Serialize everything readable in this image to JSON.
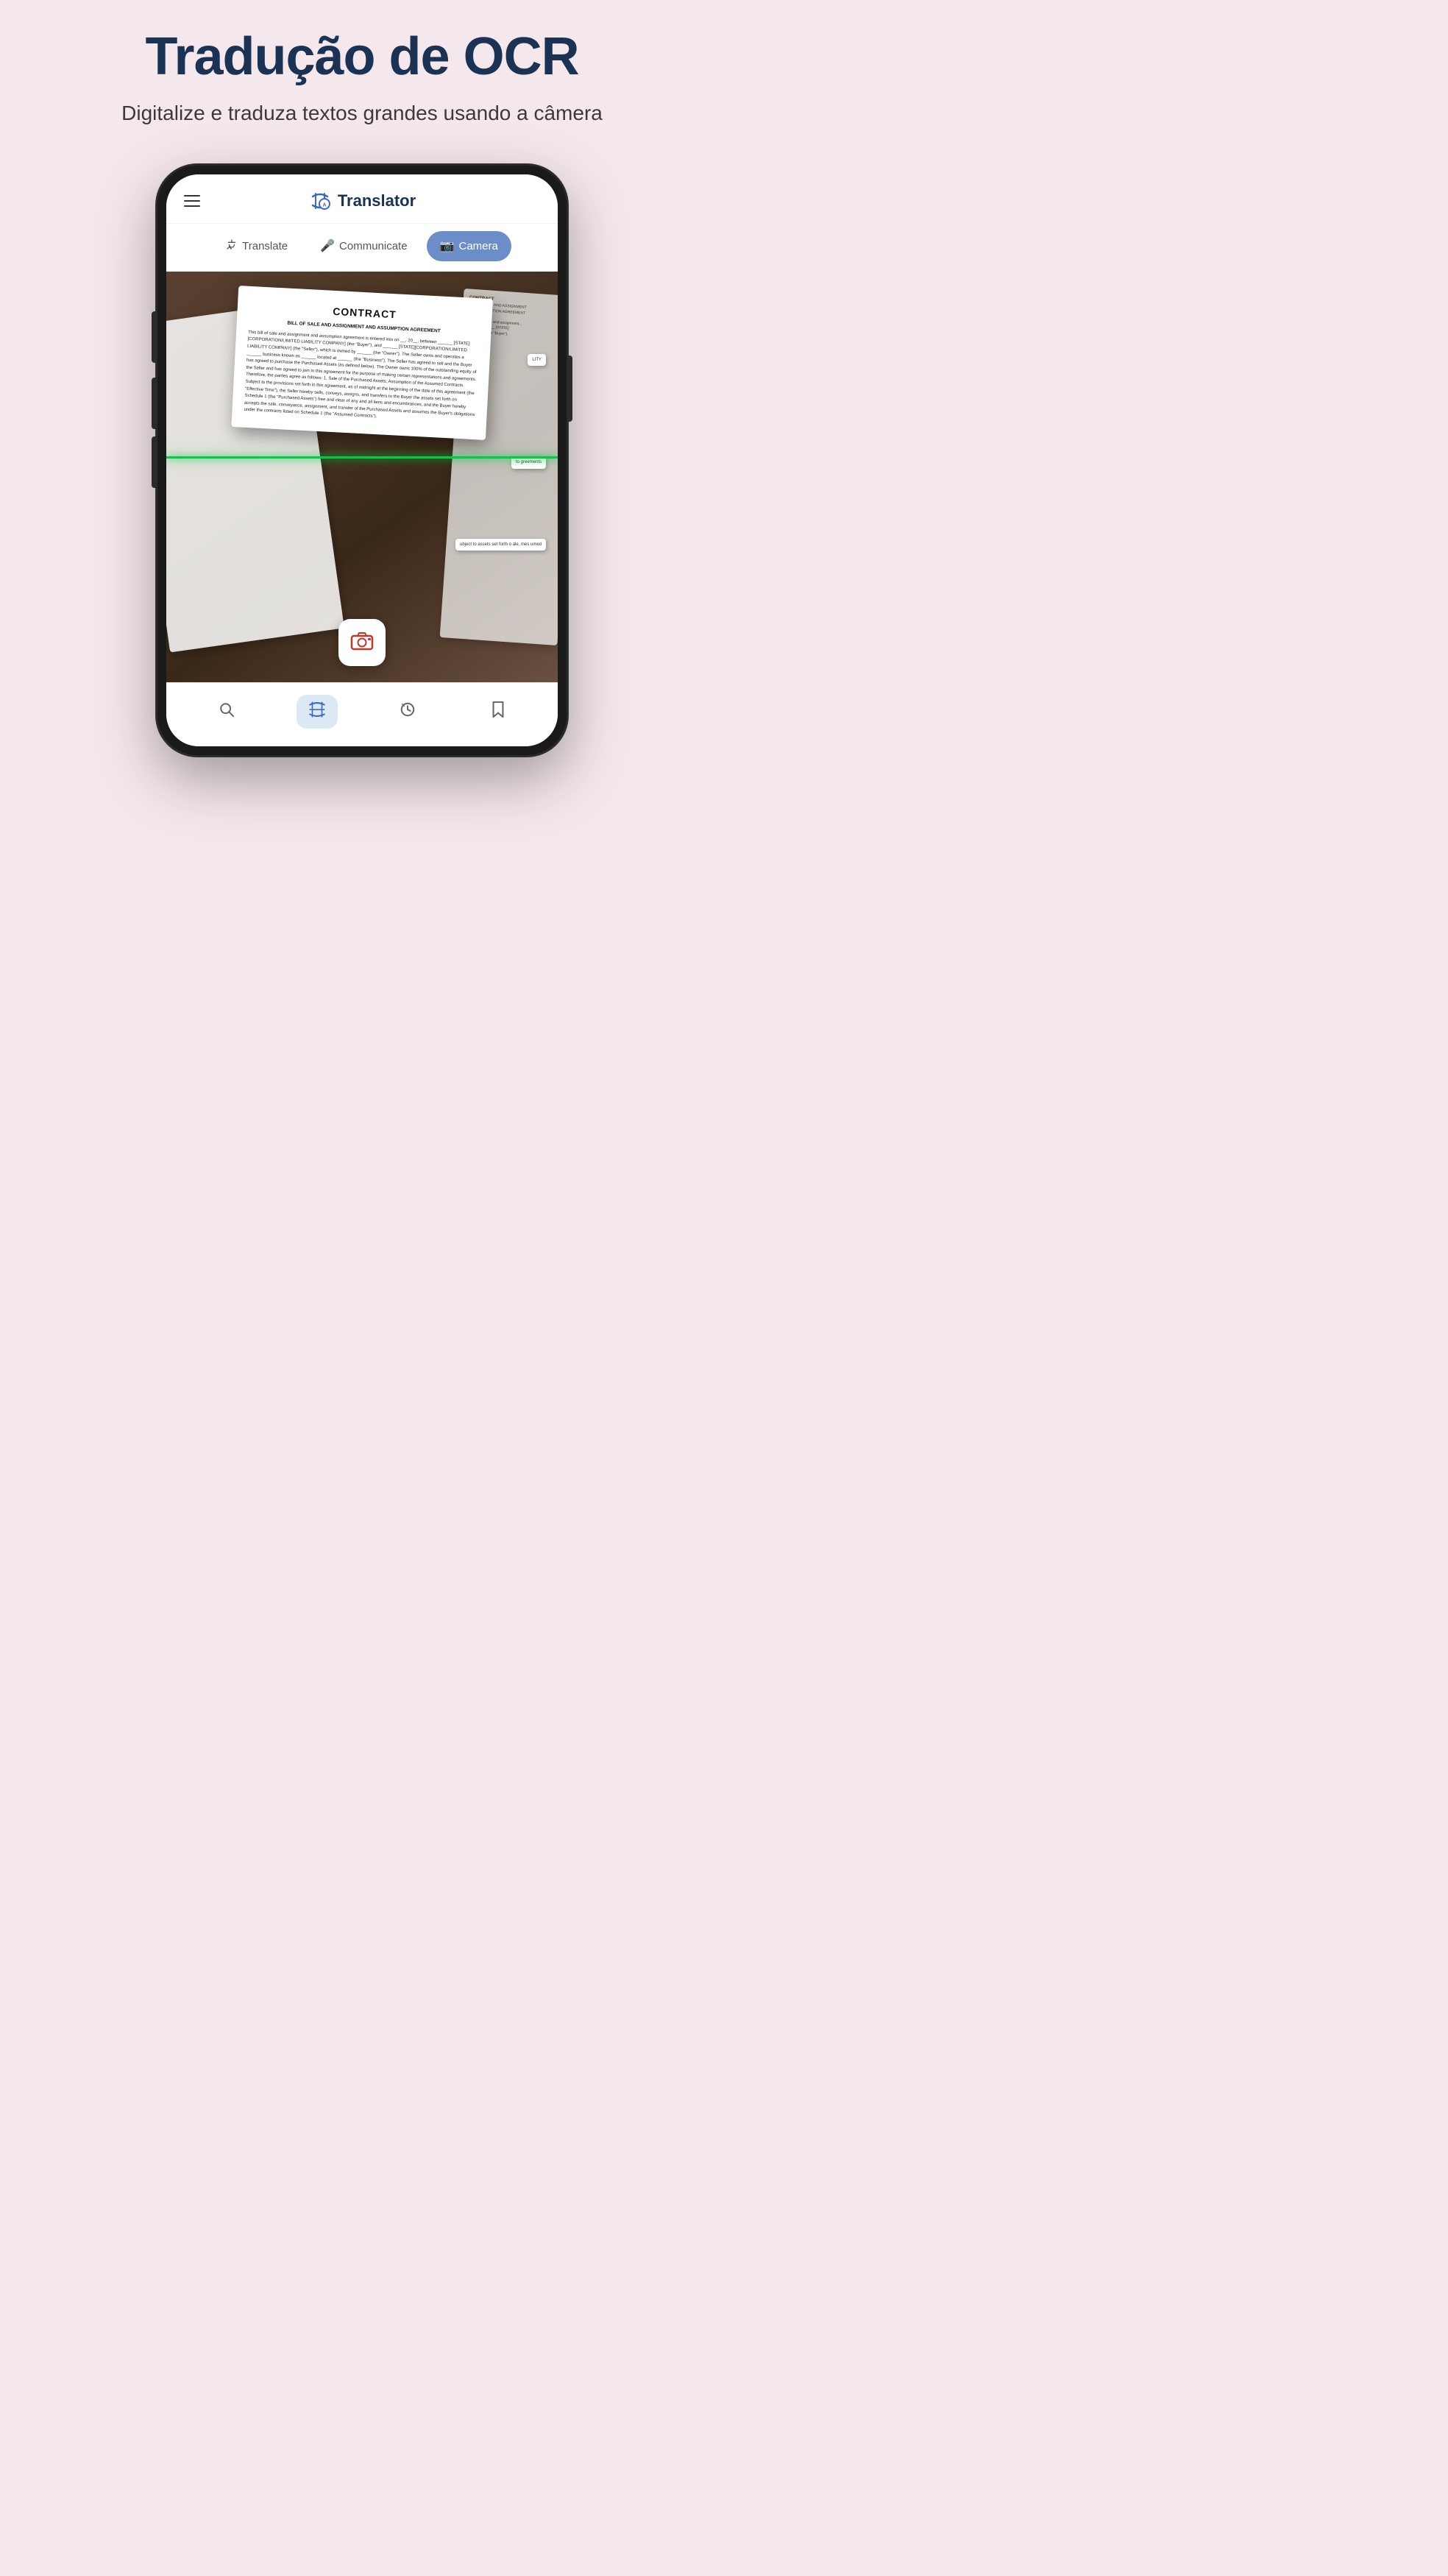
{
  "page": {
    "background_color": "#f5e8ec",
    "headline": "Tradução de OCR",
    "subtitle": "Digitalize e traduza textos grandes\nusando a câmera"
  },
  "app": {
    "title": "Translator"
  },
  "tabs": [
    {
      "id": "translate",
      "label": "Translate",
      "icon": "🔄",
      "active": false
    },
    {
      "id": "communicate",
      "label": "Communicate",
      "icon": "🎤",
      "active": false
    },
    {
      "id": "camera",
      "label": "Camera",
      "icon": "📷",
      "active": true
    }
  ],
  "contract": {
    "title": "CONTRACT",
    "subtitle": "BILL OF SALE AND ASSIGNMENT AND ASSUMPTION AGREEMENT",
    "body": "This bill of sale and assignment and assumption agreement is entered into on __, 20__, between ______ [STATE] [CORPORATION/LIMITED LIABILITY COMPANY] (the \"Buyer\"), and ______ [STATE][CORPORATION/LIMITED LIABILITY COMPANY] (the \"Seller\"), which is owned by ______ (the \"Owner\").\n\nThe Seller owns and operates a ______ business known as ______ located at ______ (the \"Business\").\n\nThe Seller has agreed to sell and the Buyer has agreed to purchase the Purchased Assets (as defined below).\n\nThe Owner owns 100% of the outstanding equity of the Seller and has agreed to join in this agreement for the purpose of making certain representations and agreements.\n\nTherefore, the parties agree as follows:\n\n1. Sale of the Purchased Assets; Assumption of the Assumed Contracts. Subject to the provisions set forth in this agreement, as of midnight at the beginning of the date of this agreement (the \"Effective Time\"), the Seller hereby sells, conveys, assigns, and transfers to the Buyer the assets set forth on Schedule 1 (the \"Purchased Assets\") free and clear of any and all liens and encumbrances, and the Buyer hereby accepts the sale, conveyance, assignment, and transfer of the Purchased Assets and assumes the Buyer's obligations under the contracts listed on Schedule 1 (the \"Assumed Contracts\")."
  },
  "right_snippets": [
    {
      "text": "LITY"
    },
    {
      "text": "to\ngreements"
    },
    {
      "text": "ubject to\nassets set forth o\nale,\nmes\numed"
    }
  ],
  "bottom_nav": [
    {
      "id": "search",
      "icon": "🔍",
      "active": false
    },
    {
      "id": "translate",
      "icon": "🔄",
      "active": true
    },
    {
      "id": "history",
      "icon": "🕐",
      "active": false
    },
    {
      "id": "bookmark",
      "icon": "🔖",
      "active": false
    }
  ]
}
